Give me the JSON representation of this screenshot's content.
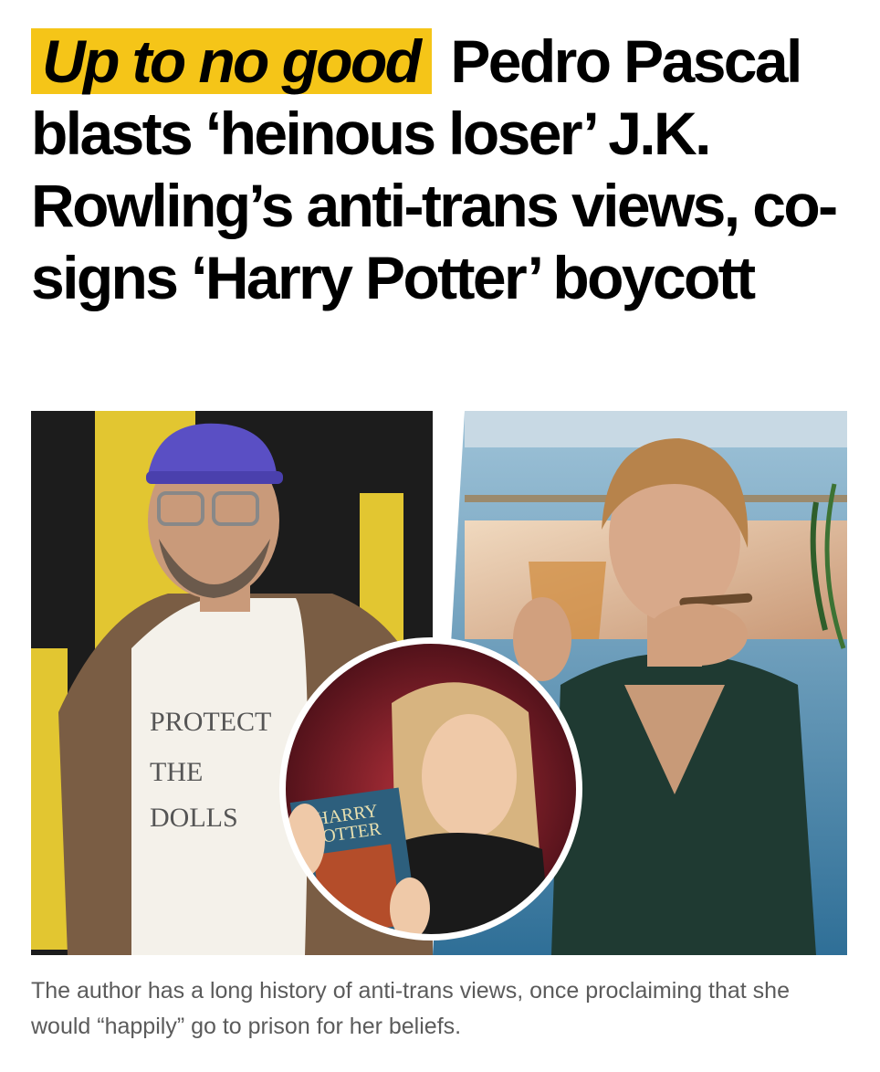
{
  "headline": {
    "kicker": "Up to no good",
    "title": "Pedro Pascal blasts ‘heinous loser’ J.K. Rowling’s anti-trans views, co-signs ‘Harry Potter’ boycott"
  },
  "photo": {
    "shirt_text": [
      "PROTECT",
      "THE",
      "DOLLS"
    ],
    "book_title": [
      "HARRY",
      "POTTER"
    ]
  },
  "caption": "The author has a long history of anti-trans views, once proclaiming that she would “happily” go to prison for her beliefs.",
  "colors": {
    "kicker_background": "#f5c518",
    "caption_text": "#5b5b5b"
  }
}
